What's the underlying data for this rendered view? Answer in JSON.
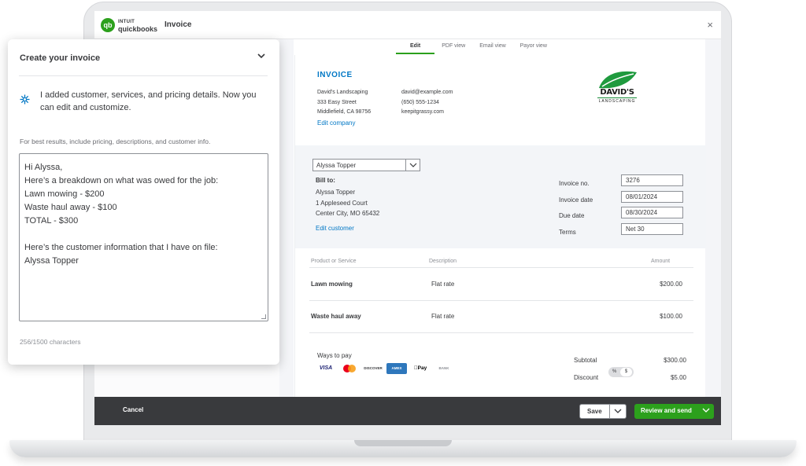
{
  "app": {
    "brand_top": "INTUIT",
    "brand_name": "quickbooks",
    "logo_glyph": "qb",
    "window_title": "Invoice",
    "close_glyph": "×"
  },
  "tabs": [
    {
      "label": "Edit",
      "active": true
    },
    {
      "label": "PDF view",
      "active": false
    },
    {
      "label": "Email view",
      "active": false
    },
    {
      "label": "Payor view",
      "active": false
    }
  ],
  "invoice": {
    "heading": "INVOICE",
    "company_name": "David's Landscaping",
    "company_street": "333 Easy Street",
    "company_city": "Middlefield, CA 98756",
    "contact_email": "david@example.com",
    "contact_phone": "(650) 555-1234",
    "contact_web": "keepitgrassy.com",
    "edit_company_label": "Edit company",
    "logo_name": "DAVID'S",
    "logo_sub": "LANDSCAPING",
    "customer_selected": "Alyssa Topper",
    "bill_to_label": "Bill to:",
    "bill_name": "Alyssa Topper",
    "bill_street": "1 Appleseed Court",
    "bill_city": "Center City, MO 65432",
    "edit_customer_label": "Edit customer",
    "meta": {
      "invoice_no_label": "Invoice no.",
      "invoice_no": "3276",
      "invoice_date_label": "Invoice date",
      "invoice_date": "08/01/2024",
      "due_date_label": "Due date",
      "due_date": "08/30/2024",
      "terms_label": "Terms",
      "terms": "Net 30"
    },
    "columns": {
      "product": "Product or Service",
      "description": "Description",
      "amount": "Amount"
    },
    "lines": [
      {
        "name": "Lawn mowing",
        "description": "Flat rate",
        "amount": "$200.00"
      },
      {
        "name": "Waste haul away",
        "description": "Flat rate",
        "amount": "$100.00"
      }
    ],
    "ways_to_pay_label": "Ways to pay",
    "payment_methods": {
      "visa": "VISA",
      "discover": "DISCOVER",
      "amex": "AMEX",
      "apple_pay": "Pay",
      "bank": "BANK"
    },
    "subtotal_label": "Subtotal",
    "subtotal": "$300.00",
    "discount_label": "Discount",
    "discount_pct_glyph": "%",
    "discount_dollar_glyph": "$",
    "discount": "$5.00"
  },
  "footer": {
    "cancel_label": "Cancel",
    "save_label": "Save",
    "review_send_label": "Review and send"
  },
  "panel": {
    "title": "Create your invoice",
    "message": "I added customer, services, and pricing details. Now you can edit and customize.",
    "hint": "For best results, include pricing, descriptions, and customer info.",
    "prompt_lines": [
      "Hi Alyssa,",
      "Here’s a breakdown on what was owed for the job:",
      "Lawn mowing - $200",
      "Waste haul away - $100",
      "TOTAL - $300",
      "",
      "Here’s the customer information that I have on file:",
      "Alyssa Topper"
    ],
    "char_count": "256/1500 characters"
  },
  "colors": {
    "brand_green": "#2ca01c",
    "link_blue": "#0077c5",
    "footer_dark": "#393a3d"
  }
}
